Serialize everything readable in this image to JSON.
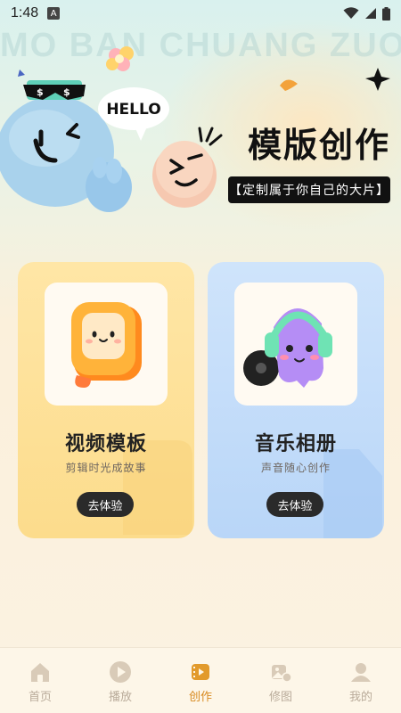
{
  "status_bar": {
    "time": "1:48",
    "notif_letter": "A"
  },
  "watermark": "MO BAN CHUANG ZUO",
  "hero": {
    "bubble_text": "HELLO",
    "title": "模版创作",
    "tagline": "【定制属于你自己的大片】"
  },
  "cards": [
    {
      "title": "视频模板",
      "subtitle": "剪辑时光成故事",
      "button": "去体验",
      "bg": "#fde3a0"
    },
    {
      "title": "音乐相册",
      "subtitle": "声音随心创作",
      "button": "去体验",
      "bg": "#c6ddfa"
    }
  ],
  "nav": {
    "items": [
      {
        "label": "首页",
        "icon": "home-icon"
      },
      {
        "label": "播放",
        "icon": "play-icon"
      },
      {
        "label": "创作",
        "icon": "create-icon"
      },
      {
        "label": "修图",
        "icon": "edit-image-icon"
      },
      {
        "label": "我的",
        "icon": "profile-icon"
      }
    ],
    "active_index": 2
  },
  "colors": {
    "accent": "#d88a1f",
    "nav_inactive": "#b9ab9a"
  }
}
